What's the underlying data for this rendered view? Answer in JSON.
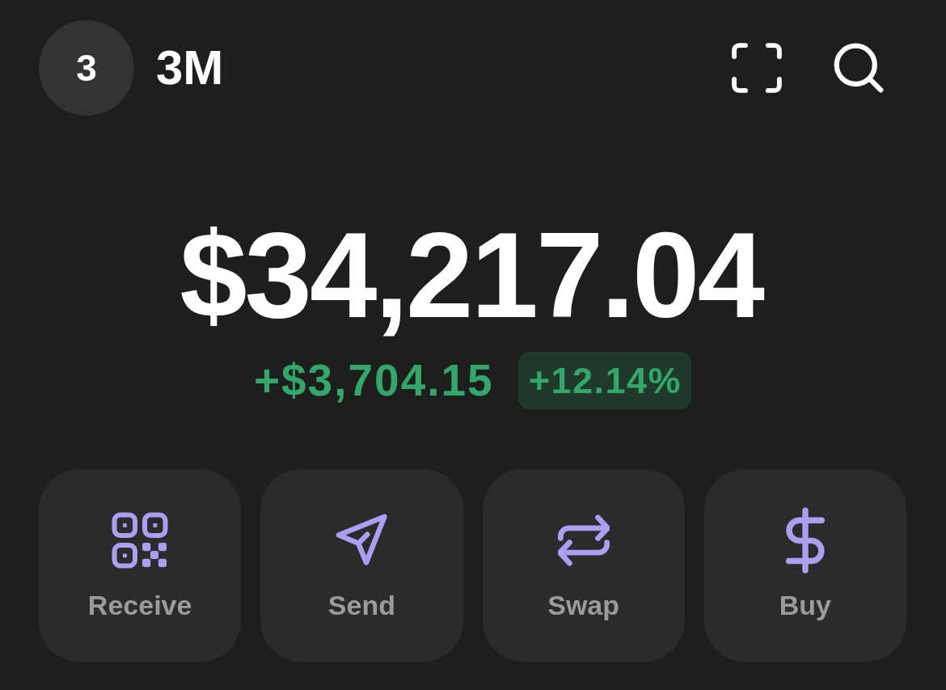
{
  "header": {
    "avatar_initial": "3",
    "account_name": "3M"
  },
  "balance": {
    "amount": "$34,217.04",
    "change_amount": "+$3,704.15",
    "change_percent": "+12.14%"
  },
  "actions": [
    {
      "kind": "receive",
      "label": "Receive"
    },
    {
      "kind": "send",
      "label": "Send"
    },
    {
      "kind": "swap",
      "label": "Swap"
    },
    {
      "kind": "buy",
      "label": "Buy"
    }
  ]
}
